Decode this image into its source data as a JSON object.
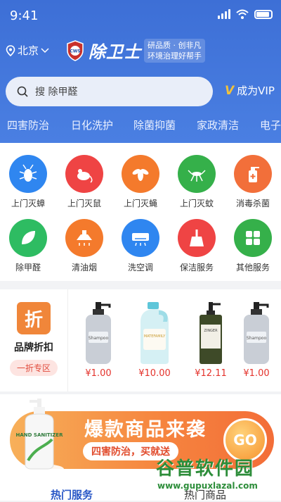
{
  "status_bar": {
    "time": "9:41"
  },
  "header": {
    "city": "北京",
    "brand": "除卫士",
    "shield_text": "CWS",
    "slogan_line1": "研品质 · 创非凡",
    "slogan_line2": "环境治理好帮手",
    "search_placeholder": "搜  除甲醛",
    "vip_label": "成为VIP"
  },
  "tabs": [
    "四害防治",
    "日化洗护",
    "除菌抑菌",
    "家政清洁",
    "电子"
  ],
  "services": [
    {
      "label": "上门灭蟑",
      "color": "#2f86f0"
    },
    {
      "label": "上门灭鼠",
      "color": "#ef4444"
    },
    {
      "label": "上门灭蝇",
      "color": "#f47a2c"
    },
    {
      "label": "上门灭蚊",
      "color": "#35b04a"
    },
    {
      "label": "消毒杀菌",
      "color": "#f26f3a"
    },
    {
      "label": "除甲醛",
      "color": "#2ebc62"
    },
    {
      "label": "清油烟",
      "color": "#f47a2c"
    },
    {
      "label": "洗空调",
      "color": "#2f86f0"
    },
    {
      "label": "保洁服务",
      "color": "#ef4444"
    },
    {
      "label": "其他服务",
      "color": "#35b04a"
    }
  ],
  "brand_discount": {
    "badge": "折",
    "title": "品牌折扣",
    "pill": "一折专区"
  },
  "products": [
    {
      "price": "¥1.00",
      "label": "Shampoo"
    },
    {
      "price": "¥10.00",
      "label": "MATEFAMILY"
    },
    {
      "price": "¥12.11",
      "label": "ZINGER"
    },
    {
      "price": "¥1.00",
      "label": "Shampoo"
    }
  ],
  "banner": {
    "title": "爆款商品来袭",
    "subtitle": "四害防治，买就送",
    "go": "GO",
    "bottle_text": "HAND SANITIZER"
  },
  "bottom_tabs": {
    "hot_services": "热门服务",
    "hot_products": "热门商品"
  },
  "watermark": {
    "line1": "谷普软件园",
    "line2": "www.gupuxlazal.com"
  }
}
